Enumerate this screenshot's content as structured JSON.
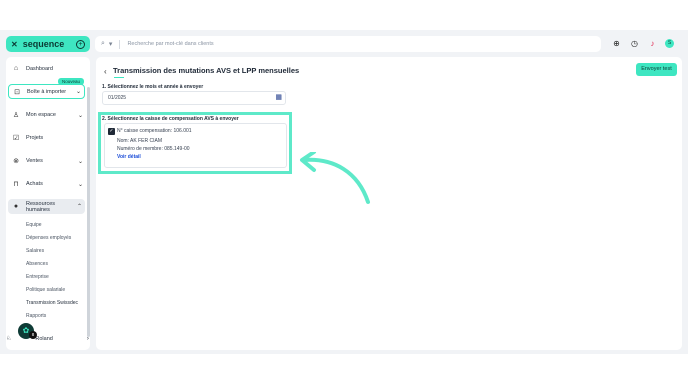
{
  "header": {
    "brand": "sequence",
    "search_placeholder": "Recherche par mot-clé dans clients",
    "avatar_initial": "S"
  },
  "sidebar": {
    "dashboard": "Dashboard",
    "inbox": "Boîte à importer",
    "new_badge": "Nouveau",
    "my_space": "Mon espace",
    "projects": "Projets",
    "sales": "Ventes",
    "purchases": "Achats",
    "hr": "Ressources humaines",
    "hr_items": [
      "Equipe",
      "Dépenses employés",
      "Salaires",
      "Absences",
      "Entreprise",
      "Politique salariale",
      "Transmission Swissdec",
      "Rapports"
    ],
    "user_name": "Roland",
    "user_badge_count": "8"
  },
  "main": {
    "title": "Transmission des mutations AVS et LPP mensuelles",
    "send_button": "Envoyer test",
    "step1_label": "1. Sélectionnez le mois et année à envoyer",
    "month_value": "01/2025",
    "step2_label": "2. Sélectionnez la caisse de compensation AVS à envoyer",
    "card": {
      "compensation": "N° caisse compensation: 106.001",
      "name": "Nom: AK FER CIAM",
      "member": "Numéro de membre: 085.149-00",
      "detail_link": "Voir détail"
    }
  },
  "colors": {
    "accent": "#3ee6c1",
    "highlight": "#5ee9c9",
    "link": "#1d4ed8"
  }
}
